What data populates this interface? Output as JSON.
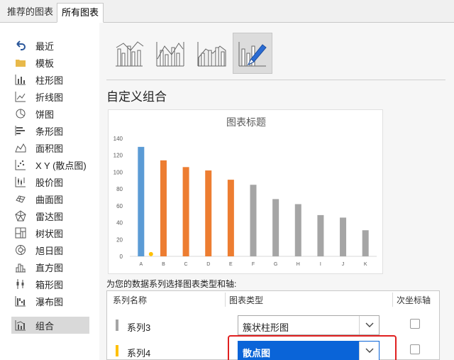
{
  "tabs": [
    {
      "label": "推荐的图表"
    },
    {
      "label": "所有图表"
    }
  ],
  "sidebar": {
    "items": [
      {
        "label": "最近",
        "icon": "undo-arrow-icon"
      },
      {
        "label": "模板",
        "icon": "folder-icon"
      },
      {
        "label": "柱形图",
        "icon": "column-chart-icon"
      },
      {
        "label": "折线图",
        "icon": "line-chart-icon"
      },
      {
        "label": "饼图",
        "icon": "pie-chart-icon"
      },
      {
        "label": "条形图",
        "icon": "bar-chart-icon"
      },
      {
        "label": "面积图",
        "icon": "area-chart-icon"
      },
      {
        "label": "X Y (散点图)",
        "icon": "scatter-chart-icon"
      },
      {
        "label": "股价图",
        "icon": "stock-chart-icon"
      },
      {
        "label": "曲面图",
        "icon": "surface-chart-icon"
      },
      {
        "label": "雷达图",
        "icon": "radar-chart-icon"
      },
      {
        "label": "树状图",
        "icon": "treemap-chart-icon"
      },
      {
        "label": "旭日图",
        "icon": "sunburst-chart-icon"
      },
      {
        "label": "直方图",
        "icon": "histogram-chart-icon"
      },
      {
        "label": "箱形图",
        "icon": "boxplot-chart-icon"
      },
      {
        "label": "瀑布图",
        "icon": "waterfall-chart-icon"
      },
      {
        "label": "组合",
        "icon": "combo-chart-icon",
        "active": true
      }
    ]
  },
  "main": {
    "heading": "自定义组合",
    "series_caption": "为您的数据系列选择图表类型和轴:",
    "table": {
      "headers": [
        "系列名称",
        "图表类型",
        "次坐标轴"
      ],
      "rows": [
        {
          "name": "系列3",
          "color": "#a5a5a5",
          "chart_type": "簇状柱形图"
        },
        {
          "name": "系列4",
          "color": "#ffc000",
          "chart_type": "散点图"
        }
      ]
    }
  },
  "colors": {
    "blue": "#5b9bd5",
    "orange": "#ed7d31",
    "gray": "#a5a5a5",
    "yellow": "#ffc000",
    "select_highlight": "#0a64d8",
    "annotation_red": "#e02020"
  },
  "chart_data": {
    "type": "bar",
    "title": "图表标题",
    "categories": [
      "A",
      "B",
      "C",
      "D",
      "E",
      "F",
      "G",
      "H",
      "I",
      "J",
      "K"
    ],
    "ylim": [
      0,
      140
    ],
    "yticks": [
      0,
      20,
      40,
      60,
      80,
      100,
      120,
      140
    ],
    "grid": false,
    "series": [
      {
        "color": "#5b9bd5",
        "values": [
          130,
          null,
          null,
          null,
          null,
          null,
          null,
          null,
          null,
          null,
          null
        ]
      },
      {
        "color": "#ed7d31",
        "values": [
          null,
          114,
          106,
          102,
          91,
          null,
          null,
          null,
          null,
          null,
          null
        ]
      },
      {
        "color": "#a5a5a5",
        "values": [
          null,
          null,
          null,
          null,
          null,
          85,
          68,
          62,
          49,
          46,
          31
        ]
      },
      {
        "color": "#ffc000",
        "kind": "scatter",
        "values": [
          1,
          null,
          null,
          null,
          null,
          null,
          null,
          null,
          null,
          null,
          null
        ]
      }
    ]
  }
}
